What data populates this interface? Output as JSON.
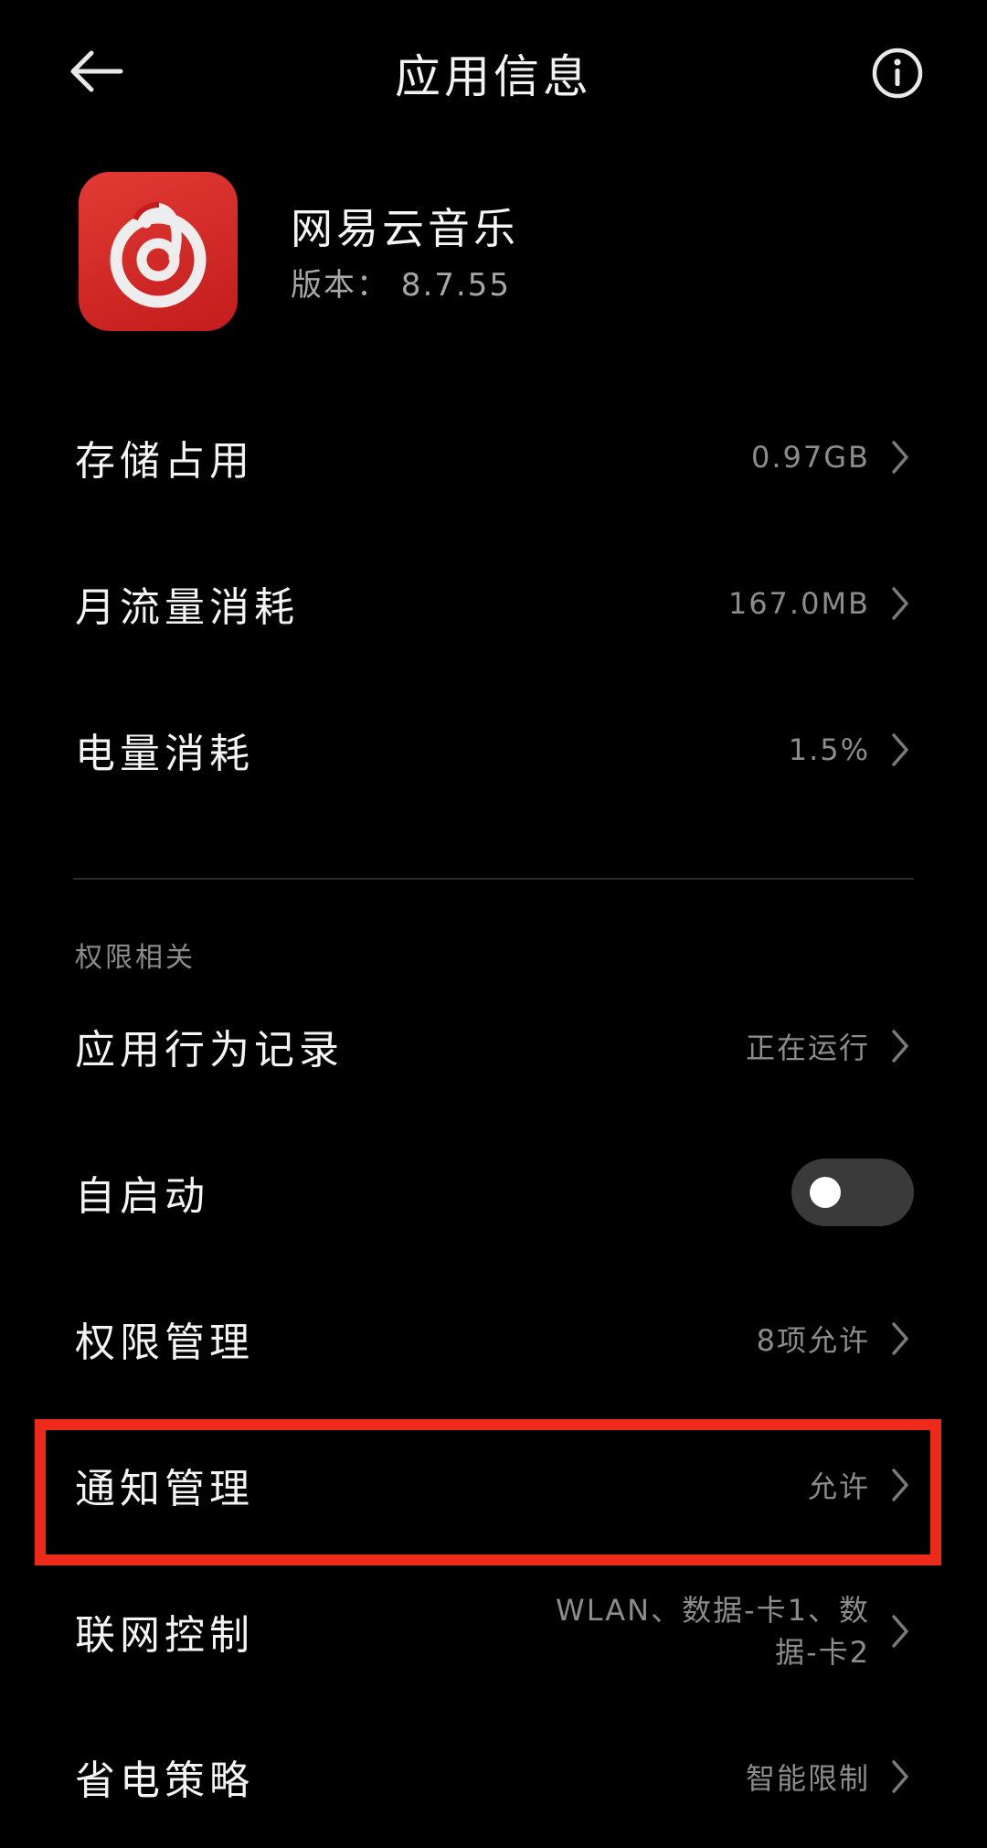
{
  "header": {
    "title": "应用信息"
  },
  "app": {
    "name": "网易云音乐",
    "version": "版本： 8.7.55",
    "icon": "netease-cloud-music-logo",
    "icon_color": "#d42323"
  },
  "usage_items": [
    {
      "label": "存储占用",
      "value": "0.97GB"
    },
    {
      "label": "月流量消耗",
      "value": "167.0MB"
    },
    {
      "label": "电量消耗",
      "value": "1.5%"
    }
  ],
  "permissions_section": {
    "title": "权限相关",
    "items": [
      {
        "label": "应用行为记录",
        "value": "正在运行"
      },
      {
        "label": "自启动",
        "toggle_on": false
      },
      {
        "label": "权限管理",
        "value": "8项允许"
      },
      {
        "label": "通知管理",
        "value": "允许",
        "highlighted": true
      },
      {
        "label": "联网控制",
        "value": "WLAN、数据-卡1、数据-卡2"
      },
      {
        "label": "省电策略",
        "value": "智能限制"
      }
    ]
  },
  "colors": {
    "background": "#000000",
    "highlight": "#ee2a1b",
    "secondary_text": "#8c8c8c"
  }
}
